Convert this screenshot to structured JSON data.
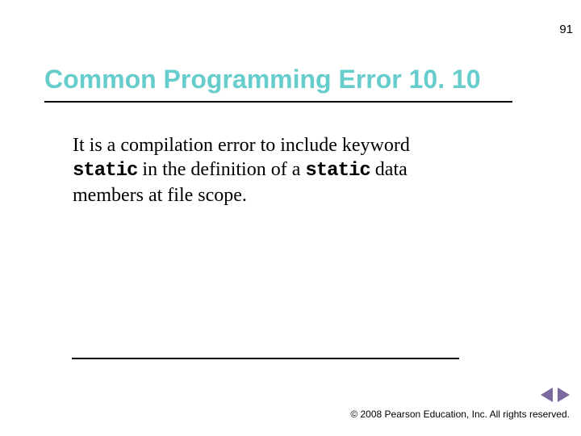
{
  "page_number": "91",
  "title": "Common Programming Error 10. 10",
  "body": {
    "part1": "It is a compilation error to include keyword ",
    "kw1": "static",
    "part2": " in the definition of a ",
    "kw2": "static",
    "part3": " data members at file scope."
  },
  "copyright": "© 2008 Pearson Education, Inc.  All rights reserved."
}
